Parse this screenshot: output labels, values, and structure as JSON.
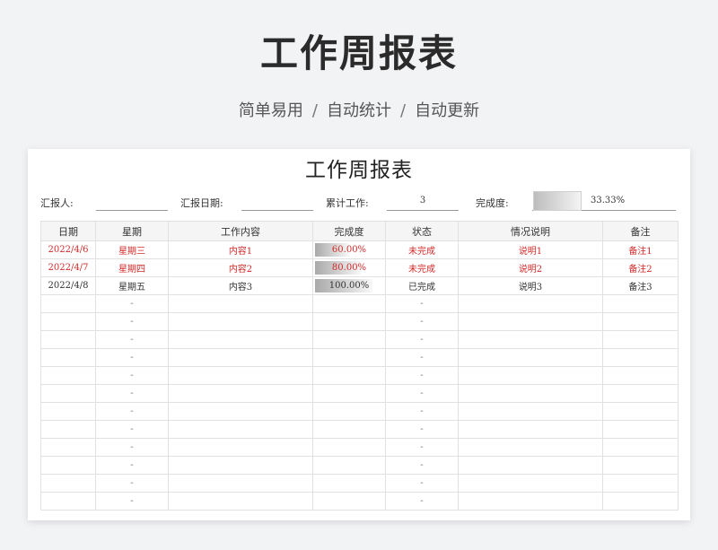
{
  "hero": {
    "title": "工作周报表",
    "subtitle_parts": [
      "简单易用",
      "/",
      "自动统计",
      "/",
      "自动更新"
    ]
  },
  "sheet": {
    "title": "工作周报表",
    "meta": {
      "reporter_label": "汇报人:",
      "reporter_value": "",
      "date_label": "汇报日期:",
      "date_value": "",
      "total_label": "累计工作:",
      "total_value": "3",
      "completion_label": "完成度:",
      "completion_value": "33.33%",
      "completion_fraction": 0.3333
    },
    "headers": [
      "日期",
      "星期",
      "工作内容",
      "完成度",
      "状态",
      "情况说明",
      "备注"
    ],
    "rows": [
      {
        "date": "2022/4/6",
        "weekday": "星期三",
        "content": "内容1",
        "pct_text": "60.00%",
        "pct": 0.6,
        "status": "未完成",
        "desc": "说明1",
        "note": "备注1",
        "style": "red"
      },
      {
        "date": "2022/4/7",
        "weekday": "星期四",
        "content": "内容2",
        "pct_text": "80.00%",
        "pct": 0.8,
        "status": "未完成",
        "desc": "说明2",
        "note": "备注2",
        "style": "red"
      },
      {
        "date": "2022/4/8",
        "weekday": "星期五",
        "content": "内容3",
        "pct_text": "100.00%",
        "pct": 1.0,
        "status": "已完成",
        "desc": "说明3",
        "note": "备注3",
        "style": "black"
      }
    ],
    "empty_placeholder": "-",
    "empty_row_count": 12
  }
}
